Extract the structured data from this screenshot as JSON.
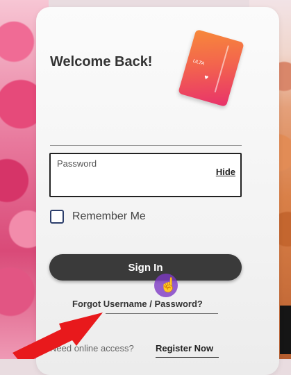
{
  "login": {
    "title": "Welcome Back!",
    "password_label": "Password",
    "hide_label": "Hide",
    "remember_label": "Remember Me",
    "signin_label": "Sign In",
    "forgot_label": "Forgot Username / Password?",
    "need_access_label": "Need online access?",
    "register_label": "Register Now"
  },
  "card": {
    "logo_text": "ULTA",
    "heart_icon": "heart-icon"
  },
  "colors": {
    "button_bg": "#3a3a3a",
    "card_gradient": [
      "#f7893a",
      "#e8326b"
    ],
    "arrow": "#e8191c",
    "cursor": "#7e3ac4"
  }
}
